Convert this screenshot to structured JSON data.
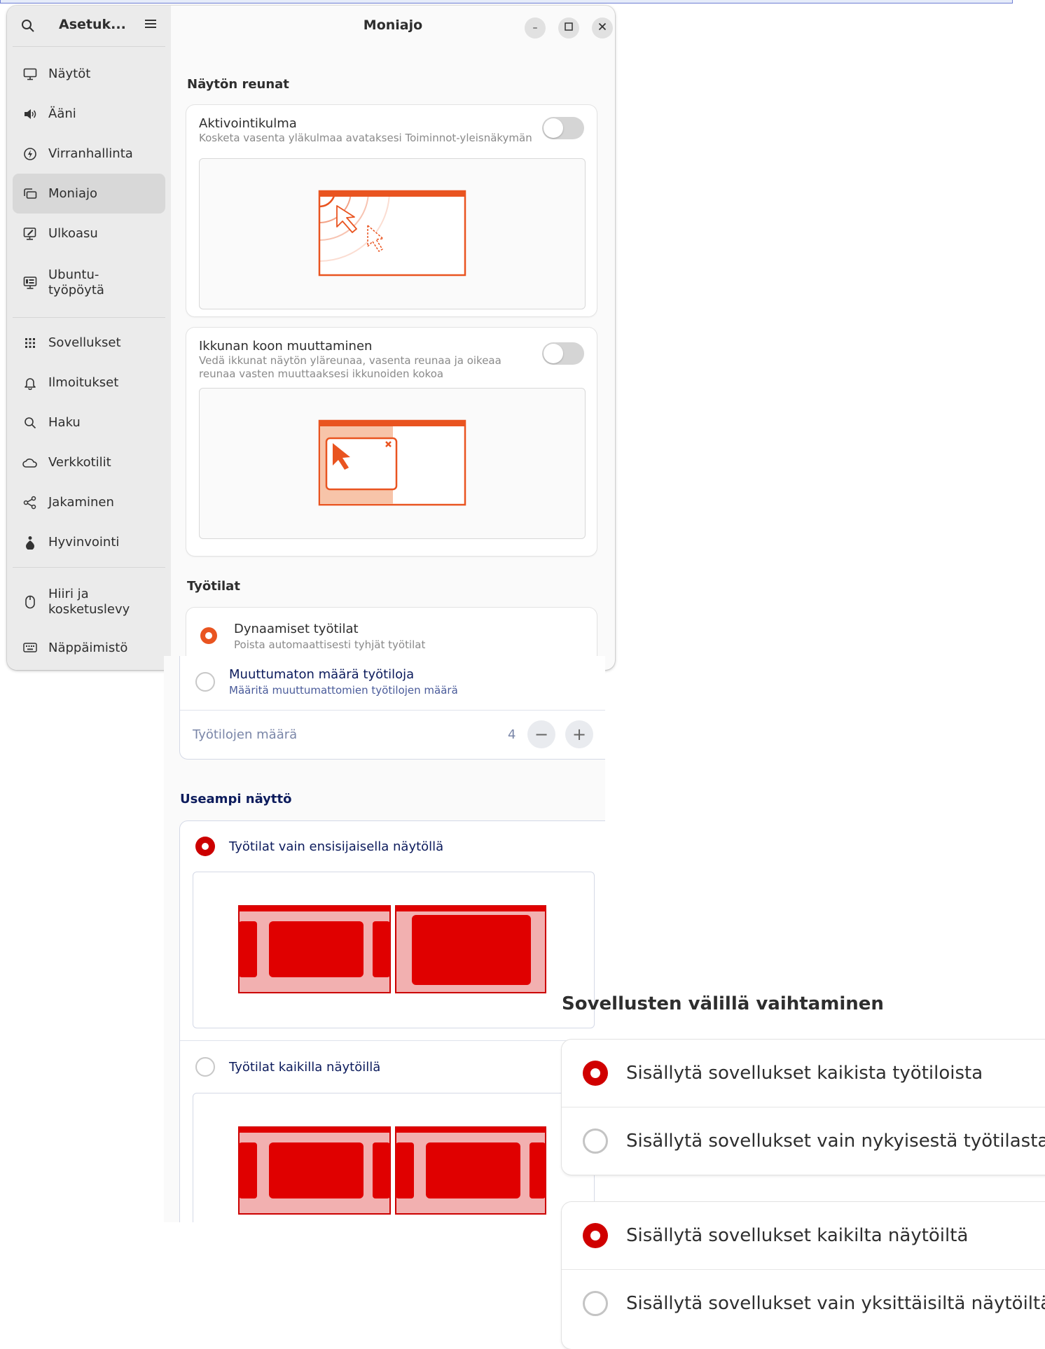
{
  "sidebar": {
    "title": "Asetuk...",
    "items": [
      {
        "label": "Näytöt",
        "icon": "display-icon"
      },
      {
        "label": "Ääni",
        "icon": "speaker-icon"
      },
      {
        "label": "Virranhallinta",
        "icon": "power-icon"
      },
      {
        "label": "Moniajo",
        "icon": "multitasking-icon",
        "active": true
      },
      {
        "label": "Ulkoasu",
        "icon": "appearance-icon"
      },
      {
        "label": "Ubuntu-\ntyöpöytä",
        "icon": "ubuntu-desktop-icon"
      },
      {
        "label": "Sovellukset",
        "icon": "apps-grid-icon"
      },
      {
        "label": "Ilmoitukset",
        "icon": "bell-icon"
      },
      {
        "label": "Haku",
        "icon": "search-icon"
      },
      {
        "label": "Verkkotilit",
        "icon": "cloud-icon"
      },
      {
        "label": "Jakaminen",
        "icon": "share-icon"
      },
      {
        "label": "Hyvinvointi",
        "icon": "wellbeing-icon"
      },
      {
        "label": "Hiiri ja\nkosketuslevy",
        "icon": "mouse-icon"
      },
      {
        "label": "Näppäimistö",
        "icon": "keyboard-icon"
      }
    ]
  },
  "window": {
    "title": "Moniajo"
  },
  "screen_edges": {
    "heading": "Näytön reunat",
    "hot_corner": {
      "title": "Aktivointikulma",
      "subtitle": "Kosketa vasenta yläkulmaa avataksesi Toiminnot-yleisnäkymän",
      "enabled": false
    },
    "resize": {
      "title": "Ikkunan koon muuttaminen",
      "subtitle": "Vedä ikkunat näytön yläreunaa, vasenta reunaa ja oikeaa reunaa vasten muuttaaksesi ikkunoiden kokoa",
      "enabled": false
    }
  },
  "workspaces": {
    "heading": "Työtilat",
    "dynamic": {
      "title": "Dynaamiset työtilat",
      "subtitle": "Poista automaattisesti tyhjät työtilat",
      "selected": true
    },
    "fixed": {
      "title": "Muuttumaton määrä työtiloja",
      "subtitle": "Määritä muuttumattomien työtilojen määrä",
      "selected": false
    },
    "count_label": "Työtilojen määrä",
    "count_value": "4",
    "decrement": "−",
    "increment": "+"
  },
  "multi_monitor": {
    "heading": "Useampi näyttö",
    "primary_only": {
      "label": "Työtilat vain ensisijaisella näytöllä",
      "selected": true
    },
    "all_displays": {
      "label": "Työtilat kaikilla näytöillä",
      "selected": false
    }
  },
  "app_switching": {
    "heading": "Sovellusten välillä vaihtaminen",
    "workspace_options": [
      {
        "label": "Sisällytä sovellukset kaikista työtiloista",
        "selected": true
      },
      {
        "label": "Sisällytä sovellukset vain nykyisestä työtilasta",
        "selected": false
      }
    ],
    "monitor_options": [
      {
        "label": "Sisällytä sovellukset kaikilta näytöiltä",
        "selected": true
      },
      {
        "label": "Sisällytä sovellukset vain yksittäisiltä näytöiltä",
        "selected": false
      }
    ]
  },
  "colors": {
    "accent": "#e95420",
    "highlight_red": "#cc0000",
    "navy_text": "#0c1b5c"
  }
}
